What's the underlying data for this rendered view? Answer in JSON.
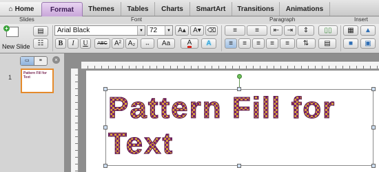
{
  "tabs": [
    "Home",
    "Format",
    "Themes",
    "Tables",
    "Charts",
    "SmartArt",
    "Transitions",
    "Animations"
  ],
  "groups": {
    "slides": "Slides",
    "font": "Font",
    "paragraph": "Paragraph",
    "insert": "Insert"
  },
  "ribbon": {
    "new_slide": "New Slide",
    "font_name": "Arial Black",
    "font_size": "72",
    "bold": "B",
    "italic": "I",
    "underline": "U",
    "strike": "ABC",
    "superscript": "A²",
    "subscript": "A₂",
    "change_case": "Aa",
    "font_color": "A",
    "text_effects": "A",
    "grow_font": "A▴",
    "shrink_font": "A▾"
  },
  "panel": {
    "slide_number": "1",
    "thumb_text": "Pattern Fill for Text"
  },
  "slide": {
    "line1": "Pattern Fill for",
    "line2": "Text"
  },
  "colors": {
    "format_tab": "#c8a6d9",
    "thumb_border": "#e58a2b",
    "pattern_dark": "#7a1f6e",
    "pattern_light": "#d9a13a"
  }
}
